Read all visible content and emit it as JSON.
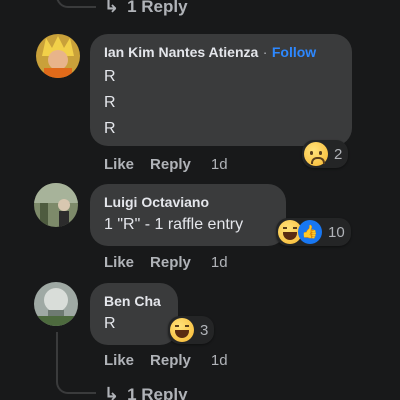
{
  "top_reply": {
    "label": "1 Reply"
  },
  "bottom_reply": {
    "label": "1 Reply"
  },
  "comments": [
    {
      "author": "Ian Kim Nantes Atienza",
      "separator": "·",
      "follow": "Follow",
      "lines": [
        "R",
        "R",
        "R"
      ],
      "like": "Like",
      "reply": "Reply",
      "time": "1d",
      "reaction_count": "2",
      "reactions": [
        "sad-emoji"
      ]
    },
    {
      "author": "Luigi Octaviano",
      "text": "1 \"R\" - 1 raffle entry",
      "like": "Like",
      "reply": "Reply",
      "time": "1d",
      "reaction_count": "10",
      "reactions": [
        "haha-emoji",
        "like-emoji"
      ]
    },
    {
      "author": "Ben Cha",
      "text": "R",
      "like": "Like",
      "reply": "Reply",
      "time": "1d",
      "reaction_count": "3",
      "reactions": [
        "haha-emoji"
      ]
    }
  ],
  "colors": {
    "background": "#18191a",
    "bubble": "#3a3b3c",
    "follow": "#2d88ff",
    "secondary_text": "#b0b3b8"
  }
}
